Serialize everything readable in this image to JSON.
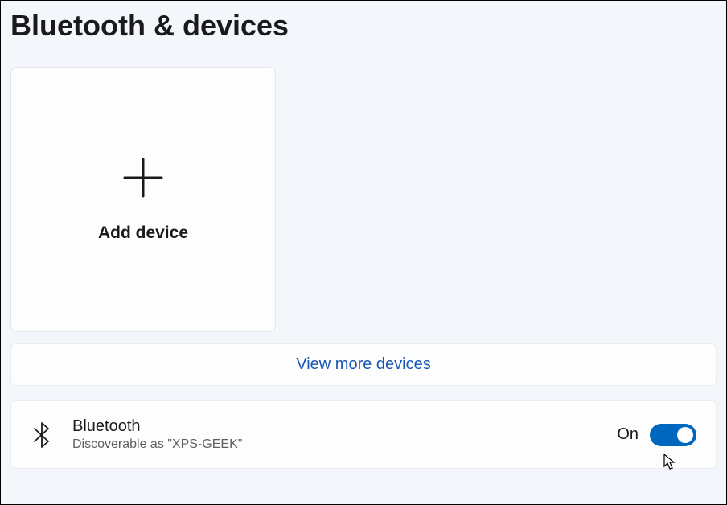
{
  "page": {
    "title": "Bluetooth & devices"
  },
  "addDevice": {
    "label": "Add device"
  },
  "viewMore": {
    "label": "View more devices"
  },
  "bluetooth": {
    "title": "Bluetooth",
    "subtitle": "Discoverable as \"XPS-GEEK\"",
    "stateLabel": "On",
    "enabled": true
  },
  "colors": {
    "accent": "#0067c0",
    "background": "#f3f6fb",
    "card": "#fdfdfe",
    "link": "#1857b6"
  }
}
